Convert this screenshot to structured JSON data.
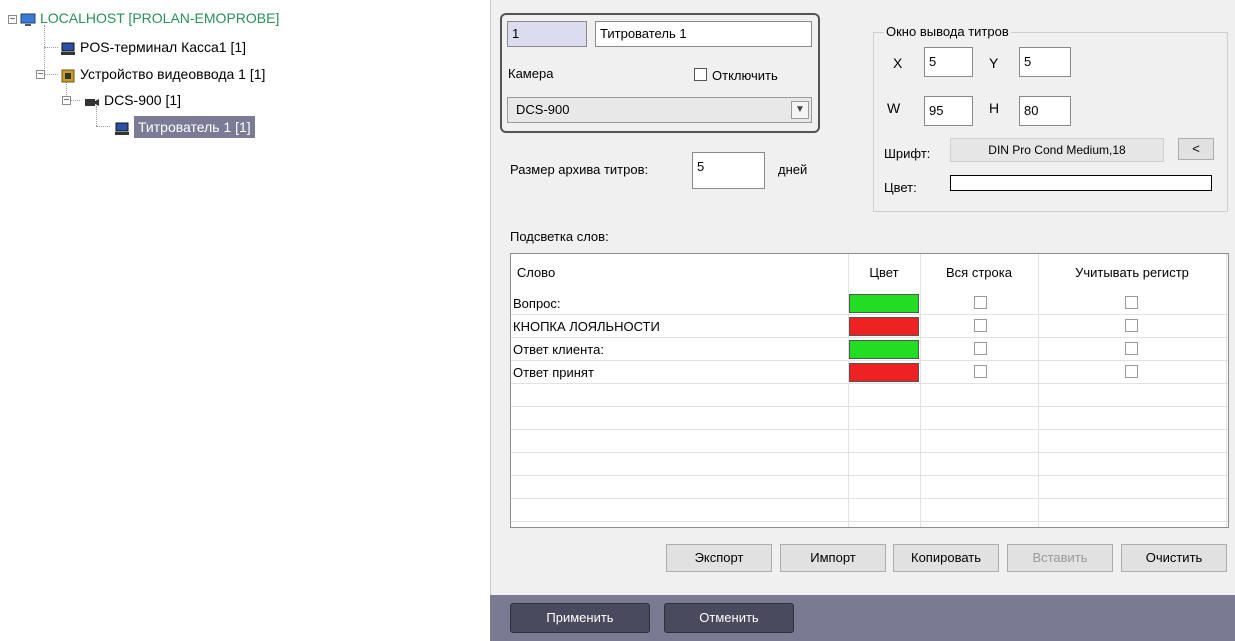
{
  "tree": {
    "root": {
      "label": "LOCALHOST [PROLAN-EMOPROBE]"
    },
    "pos_terminal": {
      "label": "POS-терминал Касса1 [1]"
    },
    "video_device": {
      "label": "Устройство видеоввода 1 [1]"
    },
    "camera": {
      "label": "DCS-900 [1]"
    },
    "titler": {
      "label": "Титрователь 1 [1]"
    }
  },
  "settings": {
    "id_value": "1",
    "name_value": "Титрователь 1",
    "camera_label": "Камера",
    "disable_label": "Отключить",
    "camera_selected": "DCS-900",
    "archive_label": "Размер архива титров:",
    "archive_value": "5",
    "archive_unit": "дней"
  },
  "output_window": {
    "title": "Окно вывода титров",
    "x_label": "X",
    "x_value": "5",
    "y_label": "Y",
    "y_value": "5",
    "w_label": "W",
    "w_value": "95",
    "h_label": "H",
    "h_value": "80",
    "font_label": "Шрифт:",
    "font_value": "DIN Pro Cond Medium,18",
    "font_button": "<",
    "color_label": "Цвет:"
  },
  "highlight": {
    "title": "Подсветка слов:",
    "columns": [
      "Слово",
      "Цвет",
      "Вся строка",
      "Учитывать регистр"
    ],
    "rows": [
      {
        "word": "Вопрос:",
        "color": "#22dd22"
      },
      {
        "word": "КНОПКА ЛОЯЛЬНОСТИ",
        "color": "#ee2222"
      },
      {
        "word": "Ответ клиента:",
        "color": "#22dd22"
      },
      {
        "word": "Ответ принят",
        "color": "#ee2222"
      }
    ]
  },
  "buttons": {
    "export": "Экспорт",
    "import": "Импорт",
    "copy": "Копировать",
    "paste": "Вставить",
    "clear": "Очистить",
    "apply": "Применить",
    "cancel": "Отменить"
  }
}
